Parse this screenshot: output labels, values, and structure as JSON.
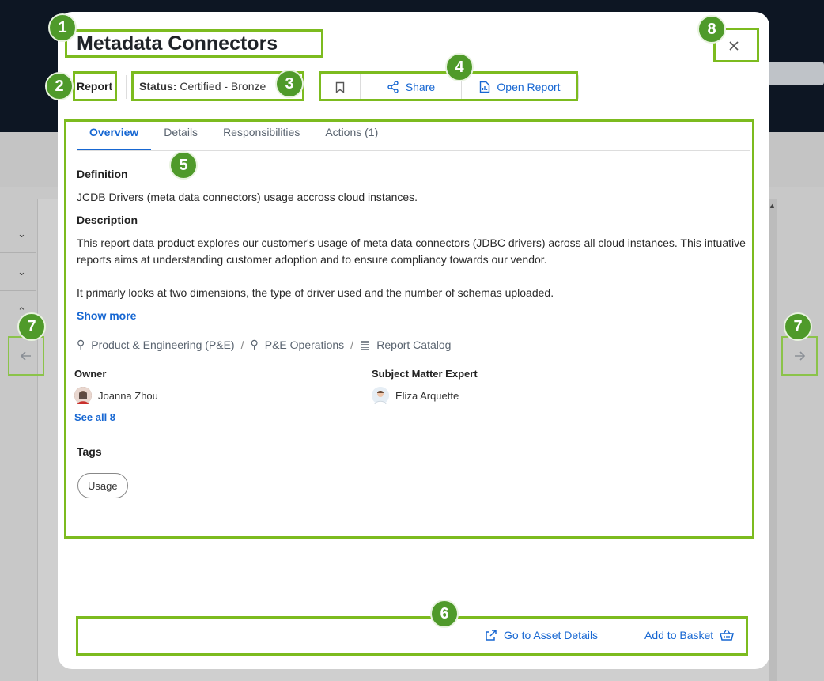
{
  "modal": {
    "title": "Metadata Connectors",
    "close_symbol": "×",
    "type_label": "Report",
    "status_label": "Status:",
    "status_value": "Certified - Bronze",
    "actions": {
      "share": "Share",
      "open_report": "Open Report"
    },
    "tabs": [
      {
        "label": "Overview"
      },
      {
        "label": "Details"
      },
      {
        "label": "Responsibilities"
      },
      {
        "label": "Actions (1)"
      }
    ],
    "definition_heading": "Definition",
    "definition_text": "JCDB Drivers (meta data connectors) usage accross cloud instances.",
    "description_heading": "Description",
    "description_p1": "This report data product explores our customer's usage of meta data connectors (JDBC drivers) across all cloud instances. This intuative reports aims at understanding customer adoption and to ensure compliancy towards our vendor.",
    "description_p2": "It primarly looks at two dimensions, the type of driver used and the number of schemas uploaded.",
    "show_more": "Show more",
    "breadcrumb": [
      "Product & Engineering (P&E)",
      "P&E Operations",
      "Report Catalog"
    ],
    "breadcrumb_sep": "/",
    "owner_heading": "Owner",
    "owner_name": "Joanna Zhou",
    "see_all": "See all 8",
    "sme_heading": "Subject Matter Expert",
    "sme_name": "Eliza Arquette",
    "tags_heading": "Tags",
    "tags": [
      "Usage"
    ],
    "footer": {
      "go_to_asset": "Go to Asset Details",
      "add_to_basket": "Add to Basket"
    }
  },
  "annotations": [
    "1",
    "2",
    "3",
    "4",
    "5",
    "6",
    "7",
    "7",
    "8"
  ],
  "colors": {
    "accent": "#1767d2",
    "highlight": "#7cbb1f",
    "badge": "#4f9a2a"
  }
}
